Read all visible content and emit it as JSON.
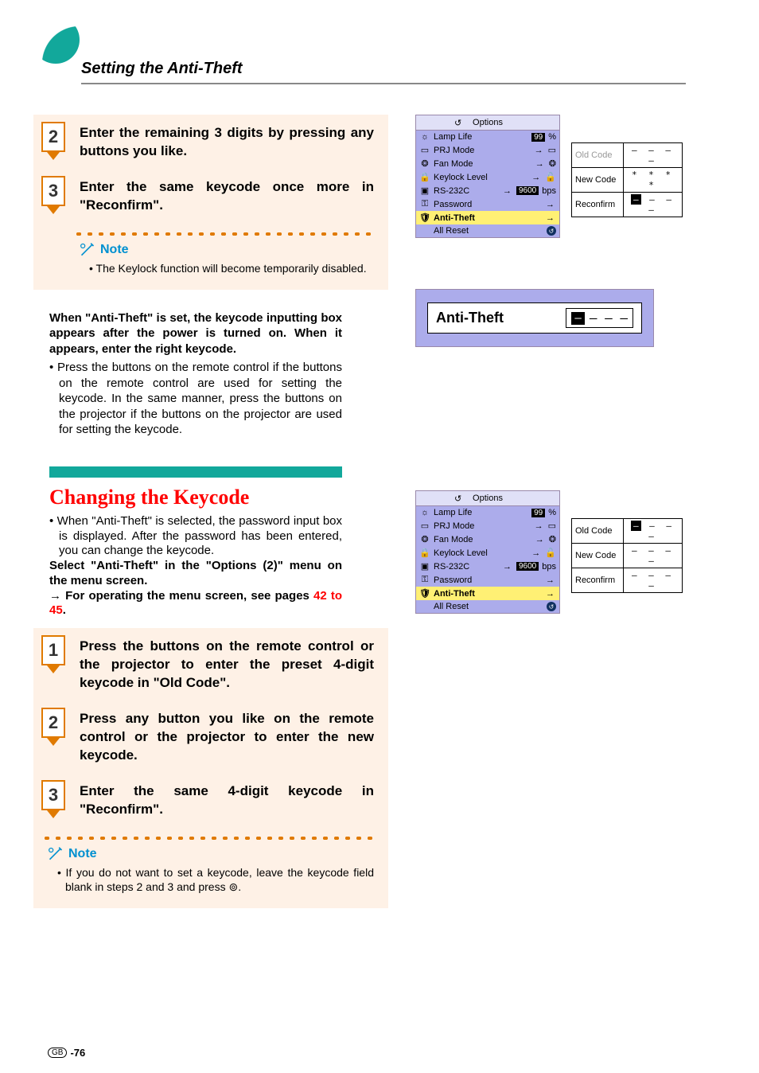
{
  "page_title": "Setting the Anti-Theft",
  "top_steps": {
    "s2": {
      "n": "2",
      "text": "Enter the remaining 3 digits by pressing any buttons you like."
    },
    "s3": {
      "n": "3",
      "text": "Enter the same keycode once more in \"Reconfirm\"."
    }
  },
  "top_note_label": "Note",
  "top_note_item": "The Keylock function will become temporarily disabled.",
  "mid_para_bold": "When \"Anti-Theft\" is set, the keycode inputting box appears after the power is turned on. When it appears, enter the right keycode.",
  "mid_para_bullet": "Press the buttons on the remote control if the buttons on the remote control are used for setting the keycode. In the same manner, press the buttons on the projector if the buttons on the projector are used for setting the keycode.",
  "section_title": "Changing the Keycode",
  "intro_bullet": "When \"Anti-Theft\" is selected, the password input box is displayed. After the password has been entered, you can change the keycode.",
  "intro_bold": "Select \"Anti-Theft\" in the \"Options (2)\" menu on the menu screen.",
  "intro_arrow": "For operating the menu screen, see pages ",
  "page_ref": "42 to 45",
  "intro_period": ".",
  "bottom_steps": {
    "s1": {
      "n": "1",
      "text": "Press the buttons on the remote control or the projector to enter the preset 4-digit keycode in \"Old Code\"."
    },
    "s2": {
      "n": "2",
      "text": "Press any button you like on the remote control or the projector to enter the new keycode."
    },
    "s3": {
      "n": "3",
      "text": "Enter the same 4-digit keycode in \"Reconfirm\"."
    }
  },
  "bottom_note_label": "Note",
  "bottom_note_item": "If you do not want to set a keycode, leave the keycode field blank in steps 2 and 3 and press ⊚.",
  "menu": {
    "header": "Options",
    "lamp": {
      "label": "Lamp Life",
      "value": "99",
      "pct": "%"
    },
    "prj": {
      "label": "PRJ Mode",
      "value": "→"
    },
    "fan": {
      "label": "Fan Mode",
      "value": "→"
    },
    "keylock": {
      "label": "Keylock Level",
      "value": "→"
    },
    "rs232": {
      "label": "RS-232C",
      "value": "9600",
      "bps": "bps"
    },
    "password": {
      "label": "Password",
      "value": "→"
    },
    "anti": {
      "label": "Anti-Theft",
      "value": "→"
    },
    "reset": {
      "label": "All Reset"
    }
  },
  "code1": {
    "old": {
      "label": "Old Code",
      "value": "– – – –"
    },
    "new": {
      "label": "New Code",
      "value": "* * * *"
    },
    "re": {
      "label": "Reconfirm",
      "cursor": "–",
      "rest": " – – –"
    }
  },
  "anti_box": {
    "label": "Anti-Theft",
    "cursor": "–",
    "rest": "– – –"
  },
  "code2": {
    "old": {
      "label": "Old Code",
      "cursor": "–",
      "rest": " – – –"
    },
    "new": {
      "label": "New Code",
      "value": "– – – –"
    },
    "re": {
      "label": "Reconfirm",
      "value": "– – – –"
    }
  },
  "footer": {
    "gb": "GB",
    "num": "-76"
  }
}
